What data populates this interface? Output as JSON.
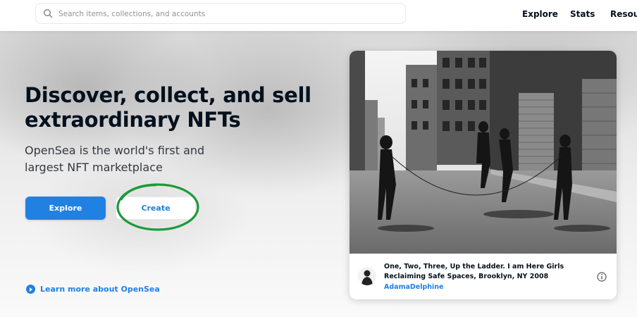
{
  "header": {
    "search": {
      "placeholder": "Search items, collections, and accounts",
      "value": ""
    },
    "nav": [
      "Explore",
      "Stats",
      "Resour"
    ]
  },
  "hero": {
    "title": "Discover, collect, and sell extraordinary NFTs",
    "subtitle": "OpenSea is the world's first and largest NFT marketplace",
    "explore_label": "Explore",
    "create_label": "Create",
    "learn_more": "Learn more about OpenSea"
  },
  "featured": {
    "title": "One, Two, Three, Up the Ladder. I am Here Girls Reclaiming Safe Spaces, Brooklyn, NY 2008",
    "artist": "AdamaDelphine"
  },
  "colors": {
    "accent": "#2081e2",
    "annotation": "#1a9a3a",
    "text": "#04111d"
  }
}
